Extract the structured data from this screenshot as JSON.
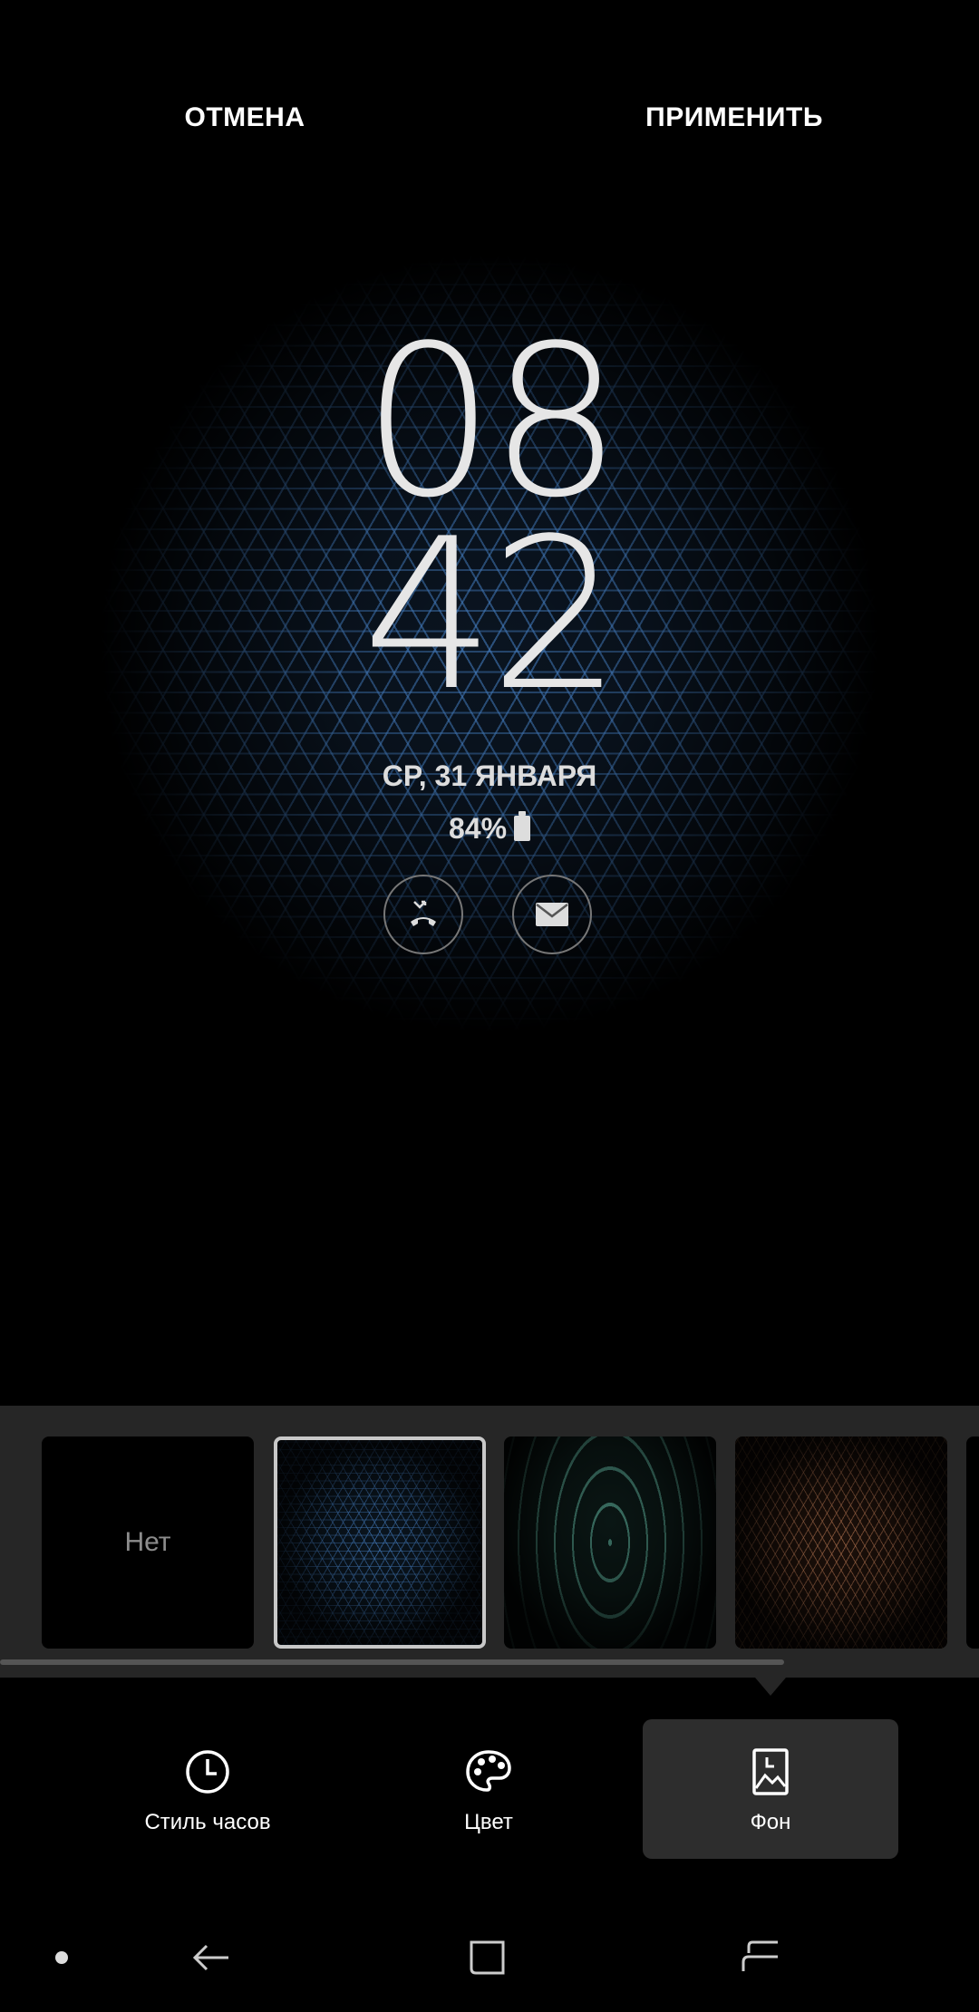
{
  "header": {
    "cancel_label": "ОТМЕНА",
    "apply_label": "ПРИМЕНИТЬ"
  },
  "preview": {
    "hours": "08",
    "minutes": "42",
    "date": "СР, 31 ЯНВАРЯ",
    "battery": "84%",
    "notifications": [
      "missed-call-icon",
      "email-icon"
    ]
  },
  "wallpapers": {
    "items": [
      {
        "label": "Нет",
        "selected": false
      },
      {
        "label": "",
        "selected": true,
        "accent": "#4682c8"
      },
      {
        "label": "",
        "selected": false,
        "accent": "#5aaa96"
      },
      {
        "label": "",
        "selected": false,
        "accent": "#c8825a"
      }
    ]
  },
  "tabs": [
    {
      "label": "Стиль часов",
      "icon": "clock-icon",
      "active": false
    },
    {
      "label": "Цвет",
      "icon": "palette-icon",
      "active": false
    },
    {
      "label": "Фон",
      "icon": "wallpaper-icon",
      "active": true
    }
  ],
  "navbar": {
    "items": [
      "dot-icon",
      "back-icon",
      "home-icon",
      "recent-apps-icon"
    ]
  },
  "colors": {
    "background": "#000000",
    "strip": "#262626",
    "active_tab": "#2d2d2d",
    "pattern_blue": "#4682c8"
  }
}
